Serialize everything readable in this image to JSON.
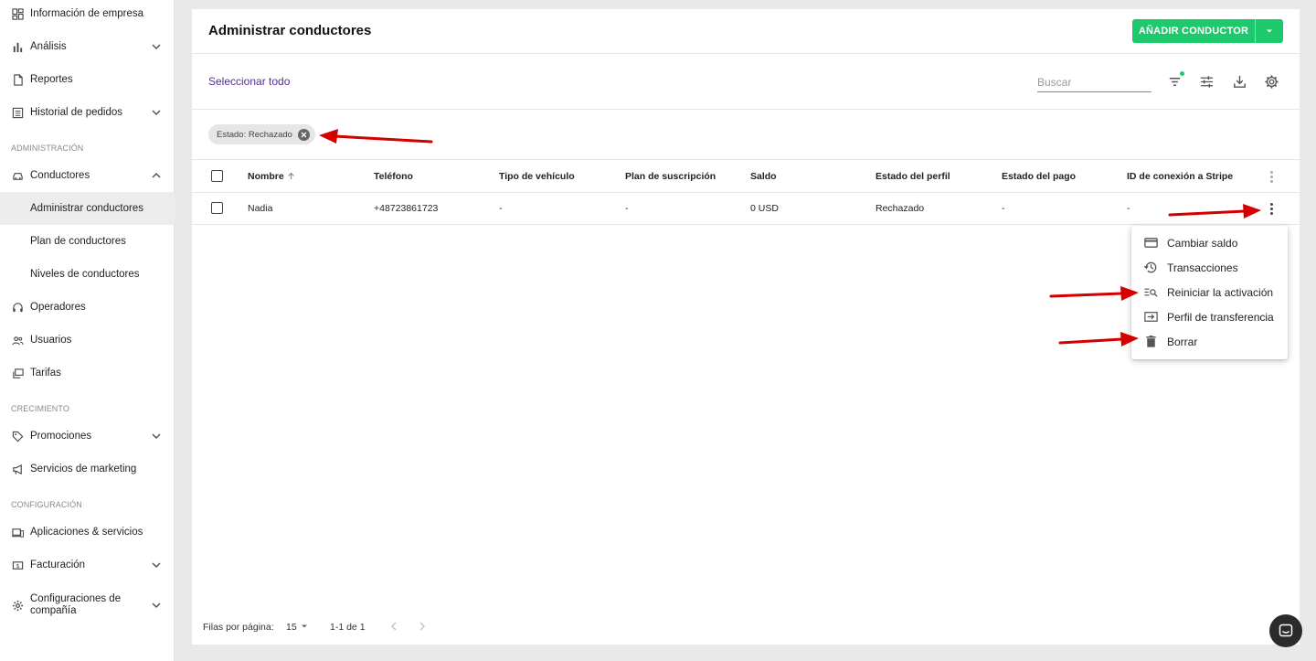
{
  "sidebar": {
    "items": [
      {
        "label": "Información de empresa",
        "icon": "dashboard-icon"
      },
      {
        "label": "Análisis",
        "icon": "bar-chart-icon"
      },
      {
        "label": "Reportes",
        "icon": "document-icon"
      },
      {
        "label": "Historial de pedidos",
        "icon": "list-icon"
      },
      {
        "label": "Conductores",
        "icon": "car-icon"
      },
      {
        "label": "Administrar conductores"
      },
      {
        "label": "Plan de conductores"
      },
      {
        "label": "Niveles de conductores"
      },
      {
        "label": "Operadores",
        "icon": "headset-icon"
      },
      {
        "label": "Usuarios",
        "icon": "users-icon"
      },
      {
        "label": "Tarifas",
        "icon": "tariffs-icon"
      },
      {
        "label": "Promociones",
        "icon": "tag-icon"
      },
      {
        "label": "Servicios de marketing",
        "icon": "megaphone-icon"
      },
      {
        "label": "Aplicaciones & servicios",
        "icon": "devices-icon"
      },
      {
        "label": "Facturación",
        "icon": "billing-icon"
      },
      {
        "label": "Configuraciones de compañía",
        "icon": "gear-icon"
      }
    ],
    "sections": {
      "admin": "ADMINISTRACIÓN",
      "growth": "CRECIMIENTO",
      "config": "CONFIGURACIÓN"
    }
  },
  "header": {
    "title": "Administrar conductores",
    "add_label": "AÑADIR CONDUCTOR"
  },
  "toolbar": {
    "select_all": "Seleccionar todo",
    "search_placeholder": "Buscar"
  },
  "filter_chip": "Estado: Rechazado",
  "table": {
    "columns": [
      "Nombre",
      "Teléfono",
      "Tipo de vehículo",
      "Plan de suscripción",
      "Saldo",
      "Estado del perfil",
      "Estado del pago",
      "ID de conexión a Stripe"
    ],
    "rows": [
      [
        "Nadia",
        "+48723861723",
        "-",
        "-",
        "0 USD",
        "Rechazado",
        "-",
        "-"
      ]
    ]
  },
  "row_menu": {
    "items": [
      {
        "label": "Cambiar saldo",
        "icon": "credit-card-icon"
      },
      {
        "label": "Transacciones",
        "icon": "history-icon"
      },
      {
        "label": "Reiniciar la activación",
        "icon": "search-list-icon"
      },
      {
        "label": "Perfil de transferencia",
        "icon": "transfer-icon"
      },
      {
        "label": "Borrar",
        "icon": "trash-icon"
      }
    ]
  },
  "footer": {
    "rows_per_page_label": "Filas por página:",
    "rows_per_page": "15",
    "range": "1-1 de 1"
  },
  "colors": {
    "accent_green": "#1ec96e",
    "link_purple": "#5a2aa0",
    "annotation_red": "#d40000"
  }
}
